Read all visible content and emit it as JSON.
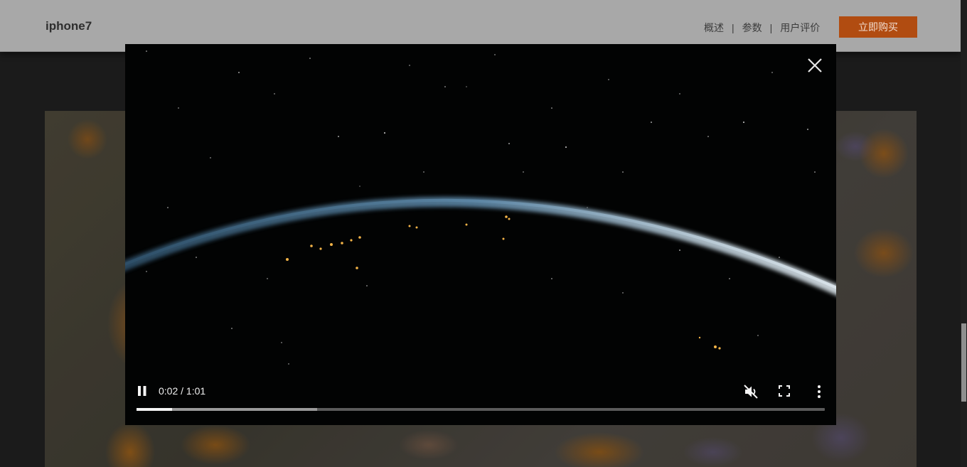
{
  "header": {
    "product_name": "iphone7",
    "nav": [
      {
        "label": "概述"
      },
      {
        "label": "参数"
      },
      {
        "label": "用户评价"
      }
    ],
    "separator": "|",
    "buy_button": "立即购买"
  },
  "video_player": {
    "time_display": "0:02 / 1:01",
    "current_time": "0:02",
    "duration": "1:01",
    "played_fraction": 0.052,
    "buffered_fraction": 0.262,
    "muted": true,
    "playing": true,
    "icons": {
      "close": "close-icon",
      "play_pause": "pause-icon",
      "mute": "mute-icon",
      "fullscreen": "fullscreen-icon",
      "more": "more-options-icon"
    }
  },
  "colors": {
    "header_bg": "#a8a8a8",
    "buy_button_bg": "#b14c11",
    "page_bg": "#1b1b1b",
    "video_bg": "#020303"
  }
}
